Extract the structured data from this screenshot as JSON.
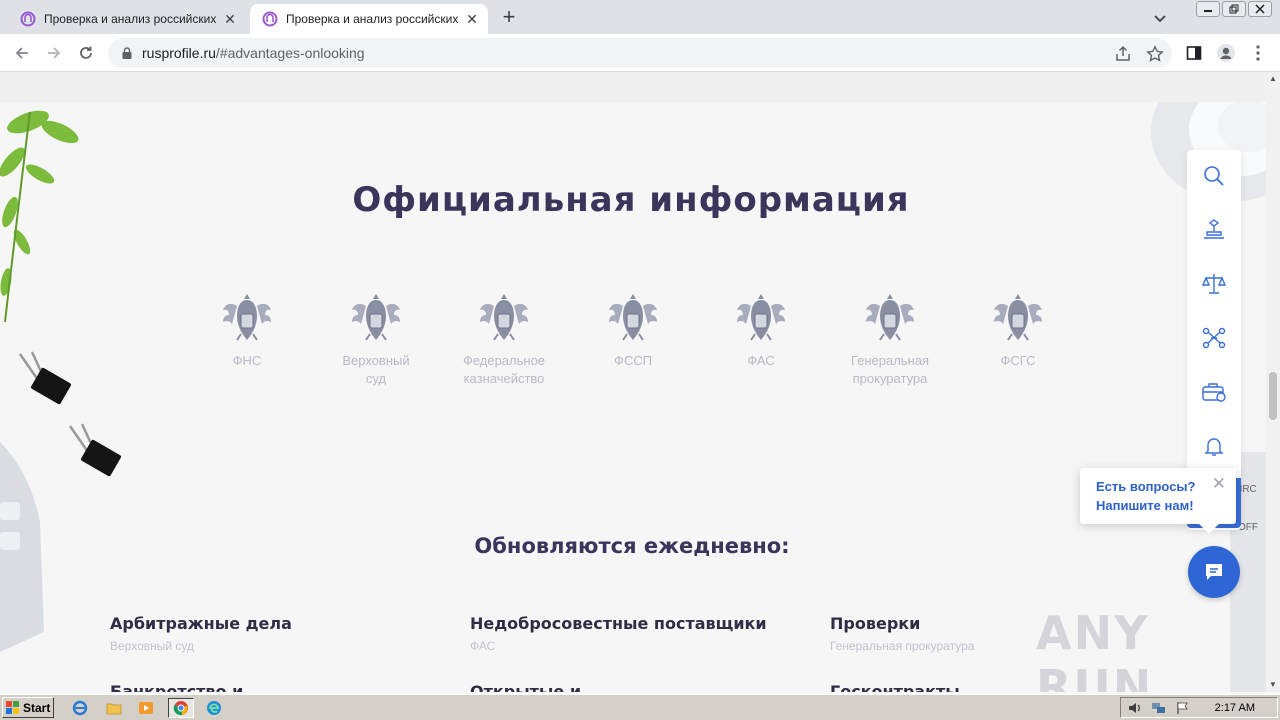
{
  "browser": {
    "tabs": [
      {
        "title": "Проверка и анализ российских юр",
        "active": false
      },
      {
        "title": "Проверка и анализ российских юр",
        "active": true
      }
    ],
    "new_tab_label": "+",
    "address": {
      "host": "rusprofile.ru",
      "path": "/#advantages-onlooking"
    }
  },
  "page": {
    "heading": "Официальная информация",
    "sources": [
      {
        "label_line1": "ФНС",
        "label_line2": ""
      },
      {
        "label_line1": "Верховный",
        "label_line2": "суд"
      },
      {
        "label_line1": "Федеральное",
        "label_line2": "казначейство"
      },
      {
        "label_line1": "ФССП",
        "label_line2": ""
      },
      {
        "label_line1": "ФАС",
        "label_line2": ""
      },
      {
        "label_line1": "Генеральная",
        "label_line2": "прокуратура"
      },
      {
        "label_line1": "ФСГС",
        "label_line2": ""
      }
    ],
    "subheading": "Обновляются ежедневно:",
    "categories": [
      {
        "title": "Арбитражные дела",
        "source": "Верховный суд"
      },
      {
        "title": "Недобросовестные поставщики",
        "source": "ФАС"
      },
      {
        "title": "Проверки",
        "source": "Генеральная прокуратура"
      }
    ],
    "categories_row2": [
      "Банкротство и ...",
      "Открытые и ...",
      "Госконтракты"
    ]
  },
  "chat": {
    "popup_line1": "Есть вопросы?",
    "popup_line2": "Напишите нам!",
    "close_label": "✕"
  },
  "side_panel": {
    "icons": [
      "search-icon",
      "stamp-icon",
      "scales-icon",
      "network-icon",
      "briefcase-icon",
      "bell-icon"
    ]
  },
  "watermark": "ANY RUN",
  "taskbar": {
    "start_label": "Start",
    "clock": "2:17 AM"
  },
  "colors": {
    "heading": "#3a355a",
    "accent_blue": "#2f66d6",
    "label_grey": "#b9bac4"
  }
}
